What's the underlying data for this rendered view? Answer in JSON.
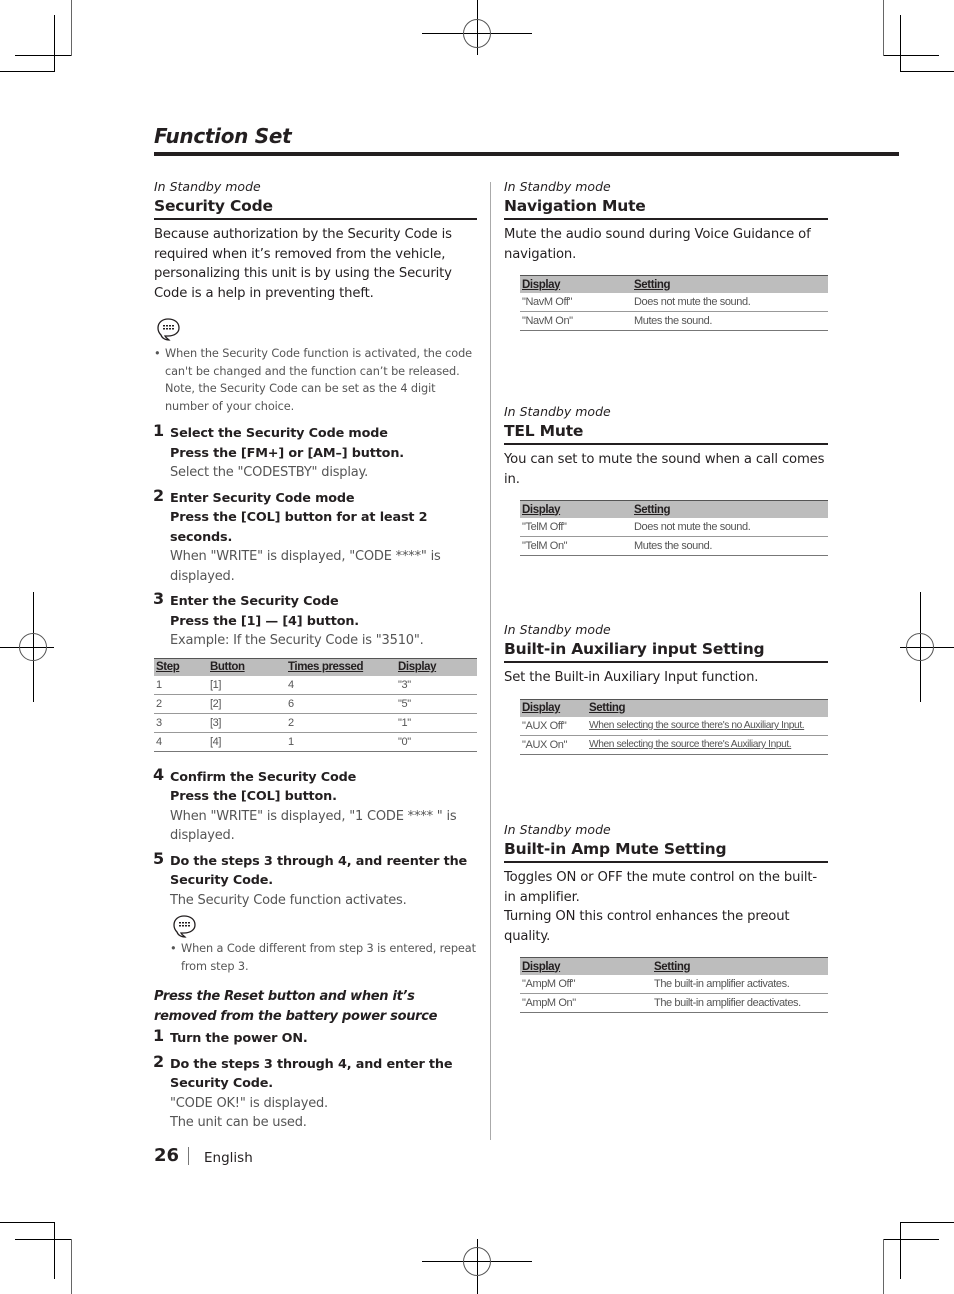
{
  "page": {
    "title": "Function Set",
    "page_number": "26",
    "language": "English"
  },
  "left": {
    "mode": "In Standby mode",
    "section_title": "Security Code",
    "intro": "Because authorization by the Security Code is required when it’s removed from the vehicle, personalizing this unit is by using the Security Code is a help in preventing theft.",
    "note_icon": "note-speech-bubble-icon",
    "note": "When the Security Code function is activated, the code can't be changed and the function can’t be released. Note, the Security Code can be set as the 4 digit number of your choice.",
    "steps": [
      {
        "num": "1",
        "title": "Select the Security Code mode",
        "action": "Press the [FM+] or [AM–] button.",
        "desc": "Select the \"CODESTBY\" display."
      },
      {
        "num": "2",
        "title": "Enter Security Code mode",
        "action": "Press the [COL] button for at least 2 seconds.",
        "desc": "When \"WRITE\" is displayed, \"CODE ****\" is displayed."
      },
      {
        "num": "3",
        "title": "Enter the Security Code",
        "action": "Press the [1] — [4] button.",
        "desc": "Example: If the Security Code is \"3510\"."
      },
      {
        "num": "4",
        "title": "Confirm the Security Code",
        "action": "Press the [COL] button.",
        "desc": "When \"WRITE\" is displayed, \"1 CODE **** \" is displayed."
      },
      {
        "num": "5",
        "title": "Do the steps 3 through 4, and reenter the Security Code.",
        "desc": "The Security Code function activates."
      }
    ],
    "code_table": {
      "headers": [
        "Step",
        "Button",
        "Times pressed",
        "Display"
      ],
      "rows": [
        [
          "1",
          "[1]",
          "4",
          "\"3\""
        ],
        [
          "2",
          "[2]",
          "6",
          "\"5\""
        ],
        [
          "3",
          "[3]",
          "2",
          "\"1\""
        ],
        [
          "4",
          "[4]",
          "1",
          "\"0\""
        ]
      ]
    },
    "note2": "When a Code different from step 3 is entered, repeat from step 3.",
    "reset_heading": "Press the Reset button and when it’s removed from the battery power source",
    "reset_steps": [
      {
        "num": "1",
        "title": "Turn the power ON."
      },
      {
        "num": "2",
        "title": "Do the steps 3 through 4, and enter the Security Code.",
        "desc1": "\"CODE OK!\" is displayed.",
        "desc2": "The unit can be used."
      }
    ]
  },
  "right": {
    "sections": [
      {
        "mode": "In Standby mode",
        "title": "Navigation Mute",
        "body": "Mute the audio sound during Voice Guidance of navigation.",
        "headers": [
          "Display",
          "Setting"
        ],
        "rows": [
          [
            "\"NavM Off\"",
            "Does not mute the sound."
          ],
          [
            "\"NavM On\"",
            "Mutes the sound."
          ]
        ]
      },
      {
        "mode": "In Standby mode",
        "title": "TEL Mute",
        "body": "You can set to mute the sound when a call comes in.",
        "headers": [
          "Display",
          "Setting"
        ],
        "rows": [
          [
            "\"TelM Off\"",
            "Does not mute the sound."
          ],
          [
            "\"TelM On\"",
            "Mutes the sound."
          ]
        ]
      },
      {
        "mode": "In Standby mode",
        "title": "Built-in Auxiliary input Setting",
        "body": "Set the Built-in Auxiliary Input function.",
        "headers": [
          "Display",
          "Setting"
        ],
        "rows": [
          [
            "\"AUX Off\"",
            "When selecting the source there's no Auxiliary Input."
          ],
          [
            "\"AUX On\"",
            "When selecting the source there's Auxiliary Input."
          ]
        ]
      },
      {
        "mode": "In Standby mode",
        "title": "Built-in Amp Mute Setting",
        "body": "Toggles ON or OFF the mute control on the built-in amplifier.",
        "body2": "Turning ON this control enhances the preout quality.",
        "headers": [
          "Display",
          "Setting"
        ],
        "rows": [
          [
            "\"AmpM Off\"",
            "The built-in amplifier activates."
          ],
          [
            "\"AmpM On\"",
            "The built-in amplifier deactivates."
          ]
        ]
      }
    ]
  }
}
